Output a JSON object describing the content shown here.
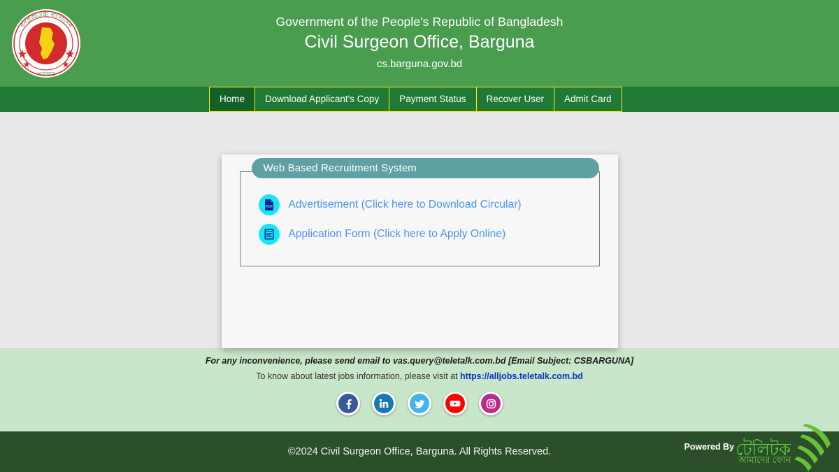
{
  "header": {
    "emblem_alt": "bangladesh-government-emblem",
    "line1": "Government of the People's Republic of Bangladesh",
    "line2": "Civil Surgeon Office, Barguna",
    "line3": "cs.barguna.gov.bd"
  },
  "nav": {
    "items": [
      {
        "label": "Home",
        "active": true
      },
      {
        "label": "Download Applicant's Copy",
        "active": false
      },
      {
        "label": "Payment Status",
        "active": false
      },
      {
        "label": "Recover User",
        "active": false
      },
      {
        "label": "Admit Card",
        "active": false
      }
    ]
  },
  "panel": {
    "legend": "Web Based Recruitment System",
    "links": [
      {
        "icon": "pdf-file-icon",
        "label": "Advertisement (Click here to Download Circular)"
      },
      {
        "icon": "application-form-icon",
        "label": "Application Form (Click here to Apply Online)"
      }
    ]
  },
  "footer": {
    "note": "For any inconvenience, please send email to vas.query@teletalk.com.bd [Email Subject: CSBARGUNA]",
    "sub_prefix": "To know about latest jobs information, please visit at ",
    "sub_link": "https://alljobs.teletalk.com.bd",
    "socials": [
      {
        "name": "facebook-icon",
        "glyph": "f"
      },
      {
        "name": "linkedin-icon",
        "glyph": "in"
      },
      {
        "name": "twitter-icon",
        "glyph": "t"
      },
      {
        "name": "youtube-icon",
        "glyph": "▶"
      },
      {
        "name": "instagram-icon",
        "glyph": "▢"
      }
    ],
    "copyright": "©2024 Civil Surgeon Office, Barguna. All Rights Reserved.",
    "powered_by": "Powered By",
    "brand_bn": "টেলিটক",
    "brand_bn_sub": "আমাদের ফোন"
  },
  "colors": {
    "header_green": "#4a9d4f",
    "nav_green": "#207a36",
    "nav_active": "#136127",
    "nav_border": "#ffe623",
    "page_bg": "#e8e8e8",
    "legend_teal": "#5fa0a2",
    "link_blue": "#4d94f5",
    "icon_cyan": "#13e7f7",
    "footer_light": "#c8e6c9",
    "footer_dark": "#2b5029",
    "footer_link": "#0b34c4"
  }
}
